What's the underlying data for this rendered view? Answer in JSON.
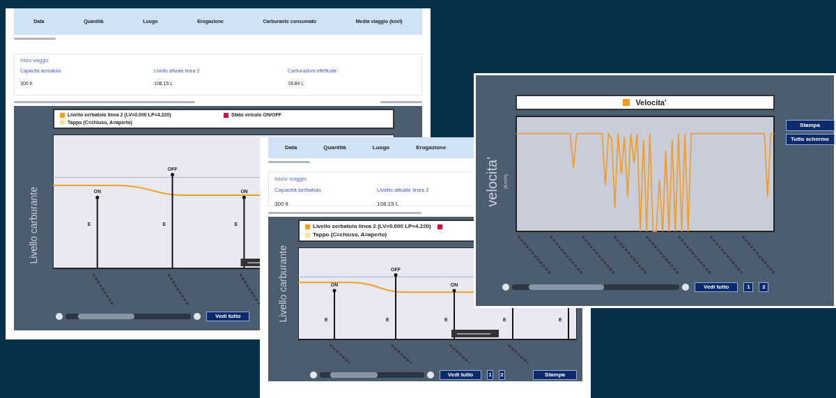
{
  "windows": [
    {
      "kind": "fuel",
      "columns": [
        "Data",
        "Quantità",
        "Luogo",
        "Erogazione",
        "Carburante consumato",
        "Media viaggio (km/l)"
      ],
      "link": "Inizio viaggio",
      "stats": [
        {
          "label": "Capacità serbatoio",
          "value": "300 lt"
        },
        {
          "label": "Livello attuale linea 2",
          "value": "108.15 L"
        },
        {
          "label": "Carburazioni effettuate",
          "value": "18.84 L"
        }
      ],
      "legend": [
        {
          "label": "Livello serbatoio linea 2 (LV=0.000 LP=4.220)",
          "color": "#f0a020"
        },
        {
          "label": "Stato veicolo ON/OFF",
          "color": "#d0103a"
        },
        {
          "label": "Tappo (C=chiuso, A=aperto)",
          "color": "#f3e6a0"
        }
      ],
      "y_label": "Livello carburante",
      "stems": [
        {
          "label": "ON",
          "tag": "E"
        },
        {
          "label": "OFF",
          "tag": "E"
        },
        {
          "label": "ON",
          "tag": "E"
        }
      ],
      "buttons": [
        {
          "label": "Vedi tutto",
          "kind": "wide"
        }
      ]
    },
    {
      "kind": "fuel",
      "columns": [
        "Data",
        "Quantità",
        "Luogo",
        "Erogazione"
      ],
      "link": "Inizio viaggio",
      "stats": [
        {
          "label": "Capacità serbatoio",
          "value": "300 lt"
        },
        {
          "label": "Livello attuale linea 2",
          "value": "108.15 L"
        }
      ],
      "legend": [
        {
          "label": "Livello serbatoio linea 2 (LV=0.000 LP=4.220)",
          "color": "#f0a020"
        },
        {
          "color": "#d0103a"
        },
        {
          "label": "Tappo (C=chiuso, A=aperto)",
          "color": "#f3e6a0"
        }
      ],
      "y_label": "Livello carburante",
      "stems": [
        {
          "label": "ON",
          "tag": "E"
        },
        {
          "label": "OFF",
          "tag": "E"
        },
        {
          "label": "ON",
          "tag": "E"
        },
        {
          "tag": "E"
        },
        {
          "tag": "E"
        }
      ],
      "buttons": [
        {
          "label": "Vedi tutto",
          "kind": "wide"
        },
        {
          "label": "1",
          "kind": "page"
        },
        {
          "label": "2",
          "kind": "page"
        },
        {
          "label": "Stampa",
          "kind": "print"
        }
      ]
    },
    {
      "kind": "speed",
      "legend": {
        "label": "Velocita'",
        "color": "#f59a1a"
      },
      "y_label": "velocita'",
      "y_unit": "(Km/h)",
      "side_buttons": [
        "Stampa",
        "Tutto schermo"
      ],
      "buttons": [
        {
          "label": "Vedi tutto",
          "kind": "wide"
        },
        {
          "label": "1",
          "kind": "page"
        },
        {
          "label": "2",
          "kind": "page"
        }
      ]
    }
  ]
}
